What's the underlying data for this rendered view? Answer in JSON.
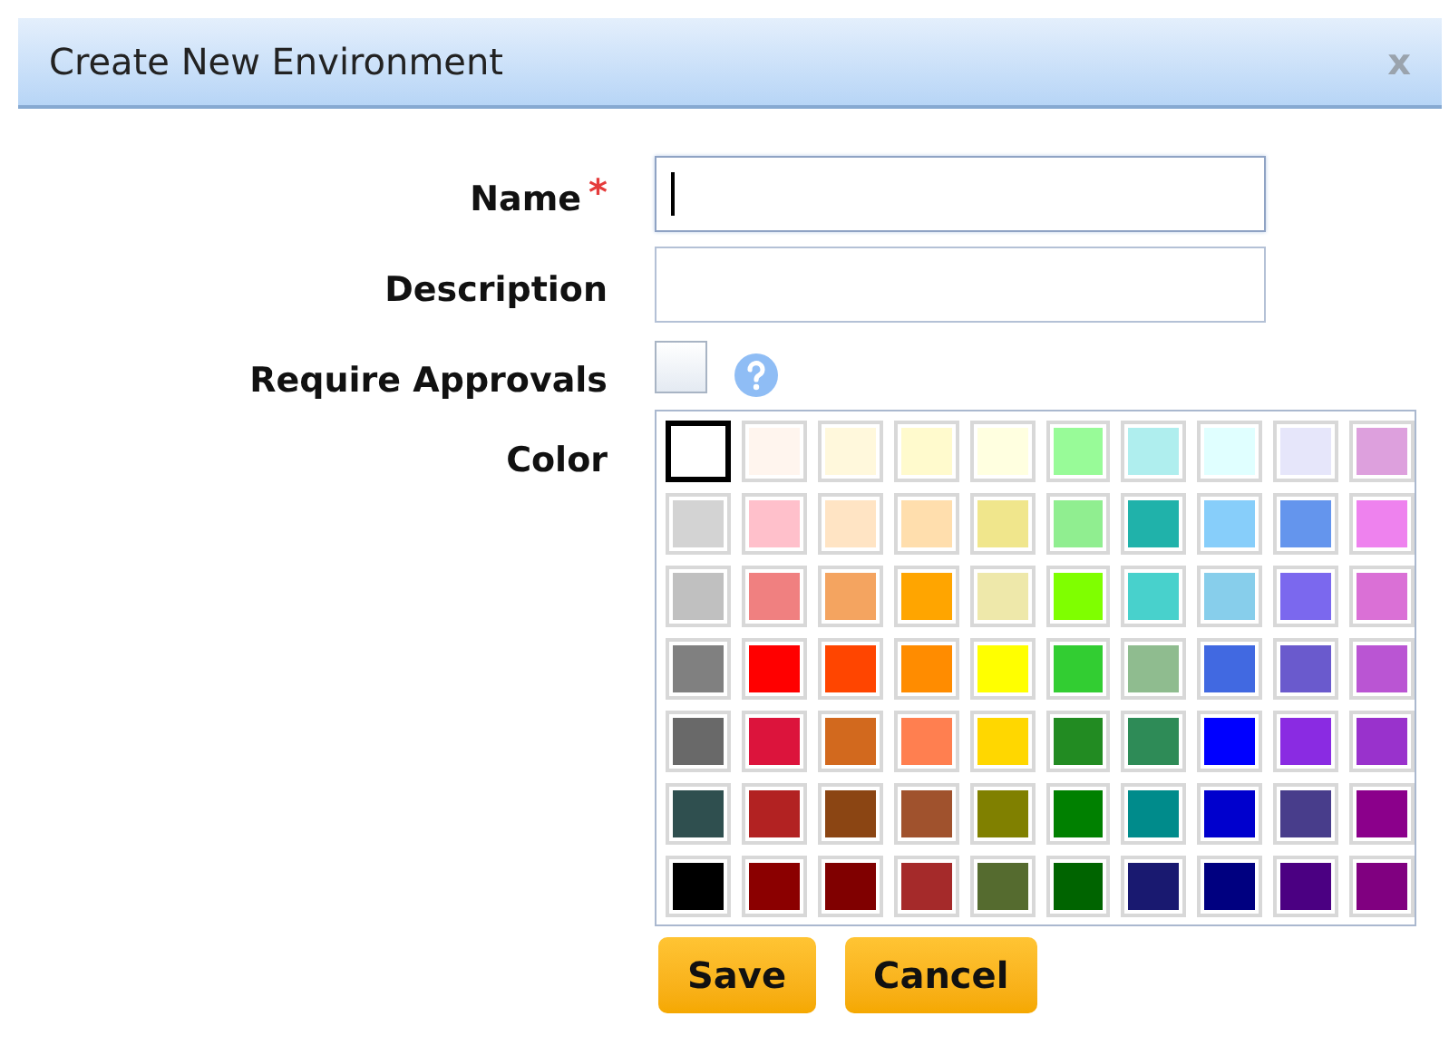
{
  "dialog": {
    "title": "Create New Environment",
    "close": "x"
  },
  "fields": [
    {
      "kind": "text",
      "label": "Name",
      "required_mark": "*",
      "focused": true
    },
    {
      "kind": "text",
      "label": "Description",
      "focused": false
    },
    {
      "kind": "checkbox",
      "label": "Require Approvals",
      "checked": false
    },
    {
      "kind": "color",
      "label": "Color"
    }
  ],
  "color_rows": [
    [
      {
        "color": "#ffffff",
        "selected": true
      },
      {
        "color": "#fff5ee",
        "selected": false
      },
      {
        "color": "#fff8dc",
        "selected": false
      },
      {
        "color": "#fffacd",
        "selected": false
      },
      {
        "color": "#ffffe0",
        "selected": false
      },
      {
        "color": "#98fb98",
        "selected": false
      },
      {
        "color": "#afeeee",
        "selected": false
      },
      {
        "color": "#e0ffff",
        "selected": false
      },
      {
        "color": "#e6e6fa",
        "selected": false
      },
      {
        "color": "#dda0dd",
        "selected": false
      }
    ],
    [
      {
        "color": "#d3d3d3",
        "selected": false
      },
      {
        "color": "#ffc0cb",
        "selected": false
      },
      {
        "color": "#ffe4c4",
        "selected": false
      },
      {
        "color": "#ffdead",
        "selected": false
      },
      {
        "color": "#f0e68c",
        "selected": false
      },
      {
        "color": "#90ee90",
        "selected": false
      },
      {
        "color": "#20b2aa",
        "selected": false
      },
      {
        "color": "#87cefa",
        "selected": false
      },
      {
        "color": "#6495ed",
        "selected": false
      },
      {
        "color": "#ee82ee",
        "selected": false
      }
    ],
    [
      {
        "color": "#c0c0c0",
        "selected": false
      },
      {
        "color": "#f08080",
        "selected": false
      },
      {
        "color": "#f4a460",
        "selected": false
      },
      {
        "color": "#ffa500",
        "selected": false
      },
      {
        "color": "#eee8aa",
        "selected": false
      },
      {
        "color": "#7fff00",
        "selected": false
      },
      {
        "color": "#48d1cc",
        "selected": false
      },
      {
        "color": "#87ceeb",
        "selected": false
      },
      {
        "color": "#7b68ee",
        "selected": false
      },
      {
        "color": "#da70d6",
        "selected": false
      }
    ],
    [
      {
        "color": "#808080",
        "selected": false
      },
      {
        "color": "#ff0000",
        "selected": false
      },
      {
        "color": "#ff4500",
        "selected": false
      },
      {
        "color": "#ff8c00",
        "selected": false
      },
      {
        "color": "#ffff00",
        "selected": false
      },
      {
        "color": "#32cd32",
        "selected": false
      },
      {
        "color": "#8fbc8f",
        "selected": false
      },
      {
        "color": "#4169e1",
        "selected": false
      },
      {
        "color": "#6a5acd",
        "selected": false
      },
      {
        "color": "#ba55d3",
        "selected": false
      }
    ],
    [
      {
        "color": "#696969",
        "selected": false
      },
      {
        "color": "#dc143c",
        "selected": false
      },
      {
        "color": "#d2691e",
        "selected": false
      },
      {
        "color": "#ff7f50",
        "selected": false
      },
      {
        "color": "#ffd700",
        "selected": false
      },
      {
        "color": "#228b22",
        "selected": false
      },
      {
        "color": "#2e8b57",
        "selected": false
      },
      {
        "color": "#0000ff",
        "selected": false
      },
      {
        "color": "#8a2be2",
        "selected": false
      },
      {
        "color": "#9932cc",
        "selected": false
      }
    ],
    [
      {
        "color": "#2f4f4f",
        "selected": false
      },
      {
        "color": "#b22222",
        "selected": false
      },
      {
        "color": "#8b4513",
        "selected": false
      },
      {
        "color": "#a0522d",
        "selected": false
      },
      {
        "color": "#808000",
        "selected": false
      },
      {
        "color": "#008000",
        "selected": false
      },
      {
        "color": "#008b8b",
        "selected": false
      },
      {
        "color": "#0000cd",
        "selected": false
      },
      {
        "color": "#483d8b",
        "selected": false
      },
      {
        "color": "#8b008b",
        "selected": false
      }
    ],
    [
      {
        "color": "#000000",
        "selected": false
      },
      {
        "color": "#8b0000",
        "selected": false
      },
      {
        "color": "#800000",
        "selected": false
      },
      {
        "color": "#a52a2a",
        "selected": false
      },
      {
        "color": "#556b2f",
        "selected": false
      },
      {
        "color": "#006400",
        "selected": false
      },
      {
        "color": "#191970",
        "selected": false
      },
      {
        "color": "#000080",
        "selected": false
      },
      {
        "color": "#4b0082",
        "selected": false
      },
      {
        "color": "#800080",
        "selected": false
      }
    ]
  ],
  "buttons": [
    "Save",
    "Cancel"
  ]
}
